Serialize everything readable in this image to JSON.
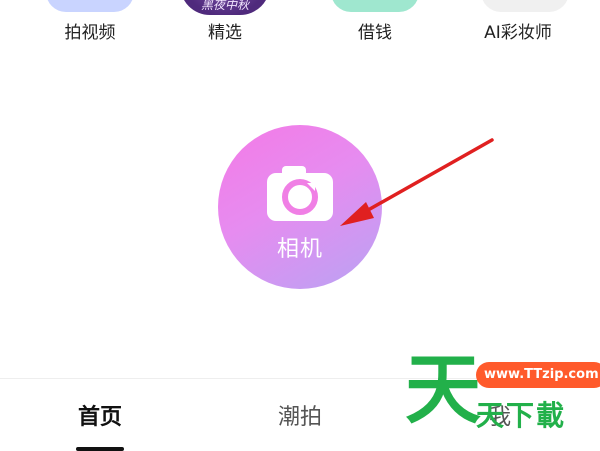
{
  "shortcuts": [
    {
      "label": "拍视频",
      "icon": "video-shortcut-icon",
      "color": "#c9d4ff"
    },
    {
      "label": "精选",
      "icon": "featured-banner-icon",
      "tile_text": "黑夜中秋",
      "color": "#5a3388"
    },
    {
      "label": "借钱",
      "icon": "loan-shortcut-icon",
      "color": "#9fe7cf"
    },
    {
      "label": "AI彩妆师",
      "icon": "ai-makeup-icon",
      "color": "#f0f0f0"
    }
  ],
  "camera": {
    "label": "相机",
    "icon": "camera-icon",
    "gradient": [
      "#f47ae6",
      "#b9a3f3"
    ]
  },
  "annotation": {
    "type": "arrow",
    "color": "#e02020"
  },
  "tabs": [
    {
      "label": "首页",
      "active": true
    },
    {
      "label": "潮拍",
      "active": false
    },
    {
      "label": "我",
      "active": false
    }
  ],
  "watermark": {
    "big": "天",
    "url": "www.TTzip.com",
    "small": "天下載",
    "color": "#22b04a",
    "url_color": "#ff5a2b"
  }
}
